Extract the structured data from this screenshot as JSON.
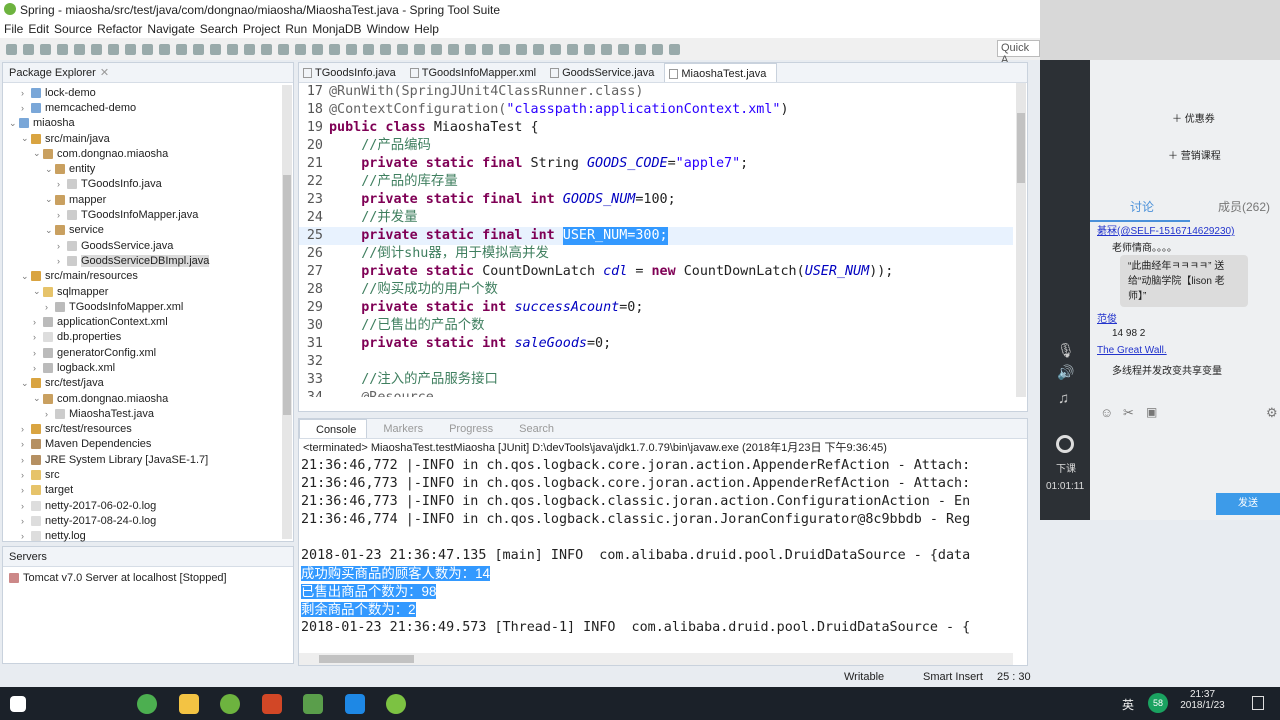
{
  "window": {
    "title": "Spring - miaosha/src/test/java/com/dongnao/miaosha/MiaoshaTest.java - Spring Tool Suite"
  },
  "menu": [
    "File",
    "Edit",
    "Source",
    "Refactor",
    "Navigate",
    "Search",
    "Project",
    "Run",
    "MonjaDB",
    "Window",
    "Help"
  ],
  "quick_access": "Quick A",
  "package_explorer": {
    "title": "Package Explorer",
    "items": [
      {
        "label": "lock-demo",
        "depth": 1,
        "icon": "project-icon"
      },
      {
        "label": "memcached-demo",
        "depth": 1,
        "icon": "project-icon"
      },
      {
        "label": "miaosha",
        "depth": 0,
        "icon": "project-icon",
        "expanded": true
      },
      {
        "label": "src/main/java",
        "depth": 1,
        "icon": "source-folder-icon",
        "expanded": true
      },
      {
        "label": "com.dongnao.miaosha",
        "depth": 2,
        "icon": "package-icon",
        "expanded": true
      },
      {
        "label": "entity",
        "depth": 3,
        "icon": "package-icon",
        "expanded": true
      },
      {
        "label": "TGoodsInfo.java",
        "depth": 4,
        "icon": "java-file-icon"
      },
      {
        "label": "mapper",
        "depth": 3,
        "icon": "package-icon",
        "expanded": true
      },
      {
        "label": "TGoodsInfoMapper.java",
        "depth": 4,
        "icon": "java-file-icon"
      },
      {
        "label": "service",
        "depth": 3,
        "icon": "package-icon",
        "expanded": true
      },
      {
        "label": "GoodsService.java",
        "depth": 4,
        "icon": "java-file-icon"
      },
      {
        "label": "GoodsServiceDBImpl.java",
        "depth": 4,
        "icon": "java-file-icon",
        "selected": true
      },
      {
        "label": "src/main/resources",
        "depth": 1,
        "icon": "source-folder-icon",
        "expanded": true
      },
      {
        "label": "sqlmapper",
        "depth": 2,
        "icon": "folder-icon",
        "expanded": true
      },
      {
        "label": "TGoodsInfoMapper.xml",
        "depth": 3,
        "icon": "xml-file-icon"
      },
      {
        "label": "applicationContext.xml",
        "depth": 2,
        "icon": "xml-file-icon"
      },
      {
        "label": "db.properties",
        "depth": 2,
        "icon": "file-icon"
      },
      {
        "label": "generatorConfig.xml",
        "depth": 2,
        "icon": "xml-file-icon"
      },
      {
        "label": "logback.xml",
        "depth": 2,
        "icon": "xml-file-icon"
      },
      {
        "label": "src/test/java",
        "depth": 1,
        "icon": "source-folder-icon",
        "expanded": true
      },
      {
        "label": "com.dongnao.miaosha",
        "depth": 2,
        "icon": "package-icon",
        "expanded": true
      },
      {
        "label": "MiaoshaTest.java",
        "depth": 3,
        "icon": "java-file-icon"
      },
      {
        "label": "src/test/resources",
        "depth": 1,
        "icon": "source-folder-icon"
      },
      {
        "label": "Maven Dependencies",
        "depth": 1,
        "icon": "library-icon"
      },
      {
        "label": "JRE System Library [JavaSE-1.7]",
        "depth": 1,
        "icon": "library-icon"
      },
      {
        "label": "src",
        "depth": 1,
        "icon": "folder-icon"
      },
      {
        "label": "target",
        "depth": 1,
        "icon": "folder-icon"
      },
      {
        "label": "netty-2017-06-02-0.log",
        "depth": 1,
        "icon": "file-icon"
      },
      {
        "label": "netty-2017-08-24-0.log",
        "depth": 1,
        "icon": "file-icon"
      },
      {
        "label": "netty.log",
        "depth": 1,
        "icon": "file-icon"
      }
    ]
  },
  "servers": {
    "title": "Servers",
    "items": [
      "Tomcat v7.0 Server at localhost  [Stopped]"
    ]
  },
  "editor": {
    "tabs": [
      "TGoodsInfo.java",
      "TGoodsInfoMapper.xml",
      "GoodsService.java",
      "MiaoshaTest.java"
    ],
    "active_tab": 3,
    "lines": [
      {
        "n": "17",
        "seg": [
          [
            "an",
            "@RunWith(SpringJUnit4ClassRunner.class)"
          ]
        ]
      },
      {
        "n": "18",
        "seg": [
          [
            "an",
            "@ContextConfiguration("
          ],
          [
            "str",
            "\"classpath:applicationContext.xml\""
          ],
          [
            "",
            ")"
          ]
        ]
      },
      {
        "n": "19",
        "seg": [
          [
            "kw",
            "public class "
          ],
          [
            "",
            "MiaoshaTest {"
          ]
        ]
      },
      {
        "n": "20",
        "seg": [
          [
            "cm",
            "    //产品编码"
          ]
        ]
      },
      {
        "n": "21",
        "seg": [
          [
            "kw",
            "    private static final "
          ],
          [
            "",
            "String "
          ],
          [
            "fld",
            "GOODS_CODE"
          ],
          [
            "",
            "="
          ],
          [
            "str",
            "\"apple7\""
          ],
          [
            "",
            ";"
          ]
        ]
      },
      {
        "n": "22",
        "seg": [
          [
            "cm",
            "    //产品的库存量"
          ]
        ]
      },
      {
        "n": "23",
        "seg": [
          [
            "kw",
            "    private static final int "
          ],
          [
            "fld",
            "GOODS_NUM"
          ],
          [
            "",
            "=100;"
          ]
        ]
      },
      {
        "n": "24",
        "seg": [
          [
            "cm",
            "    //并发量"
          ]
        ]
      },
      {
        "n": "25",
        "seg": [
          [
            "kw",
            "    private static final int "
          ],
          [
            "selt",
            "USER_NUM=300;"
          ]
        ],
        "current": true
      },
      {
        "n": "26",
        "seg": [
          [
            "cm",
            "    //倒计shu器，用于模拟高并发"
          ]
        ]
      },
      {
        "n": "27",
        "seg": [
          [
            "kw",
            "    private static "
          ],
          [
            "",
            "CountDownLatch "
          ],
          [
            "fld",
            "cdl"
          ],
          [
            "",
            " = "
          ],
          [
            "kw",
            "new "
          ],
          [
            "",
            "CountDownLatch("
          ],
          [
            "fld",
            "USER_NUM"
          ],
          [
            "",
            "));"
          ]
        ]
      },
      {
        "n": "28",
        "seg": [
          [
            "cm",
            "    //购买成功的用户个数"
          ]
        ]
      },
      {
        "n": "29",
        "seg": [
          [
            "kw",
            "    private static int "
          ],
          [
            "fld",
            "successAcount"
          ],
          [
            "",
            "=0;"
          ]
        ]
      },
      {
        "n": "30",
        "seg": [
          [
            "cm",
            "    //已售出的产品个数"
          ]
        ]
      },
      {
        "n": "31",
        "seg": [
          [
            "kw",
            "    private static int "
          ],
          [
            "fld",
            "saleGoods"
          ],
          [
            "",
            "=0;"
          ]
        ]
      },
      {
        "n": "32",
        "seg": [
          [
            "",
            ""
          ]
        ]
      },
      {
        "n": "33",
        "seg": [
          [
            "cm",
            "    //注入的产品服务接口"
          ]
        ]
      },
      {
        "n": "34",
        "seg": [
          [
            "an",
            "    @Resource"
          ]
        ]
      }
    ]
  },
  "console": {
    "tabs": [
      "Console",
      "Markers",
      "Progress",
      "Search"
    ],
    "header": "<terminated> MiaoshaTest.testMiaosha [JUnit] D:\\devTools\\java\\jdk1.7.0.79\\bin\\javaw.exe (2018年1月23日 下午9:36:45)",
    "lines": [
      "21:36:46,772 |-INFO in ch.qos.logback.core.joran.action.AppenderRefAction - Attach:",
      "21:36:46,773 |-INFO in ch.qos.logback.core.joran.action.AppenderRefAction - Attach:",
      "21:36:46,773 |-INFO in ch.qos.logback.classic.joran.action.ConfigurationAction - En",
      "21:36:46,774 |-INFO in ch.qos.logback.classic.joran.JoranConfigurator@8c9bbdb - Reg",
      "",
      "2018-01-23 21:36:47.135 [main] INFO  com.alibaba.druid.pool.DruidDataSource - {data",
      "成功购买商品的顾客人数为：14",
      "已售出商品个数为：98",
      "剩余商品个数为：2",
      "2018-01-23 21:36:49.573 [Thread-1] INFO  com.alibaba.druid.pool.DruidDataSource - {"
    ],
    "highlighted": [
      6,
      7,
      8
    ]
  },
  "status": {
    "writable": "Writable",
    "insert": "Smart Insert",
    "position": "25 : 30"
  },
  "chat": {
    "menu": [
      "优惠券",
      "营销课程"
    ],
    "tabs": [
      "讨论",
      "成员(262)"
    ],
    "messages": [
      {
        "user": "綦冧(@SELF-1516714629230)",
        "text": "老师情商。。。。"
      },
      {
        "gift": "“此曲经年ㅋㅋㅋㅋ” 送给“动脑学院【lison 老师】”"
      },
      {
        "user": "范俊",
        "text": "14 98 2"
      },
      {
        "user": "The Great Wall.",
        "text": "多线程并发改变共享变量"
      }
    ],
    "send": "发送",
    "end_class": "下课",
    "timer": "01:01:11"
  },
  "taskbar": {
    "time": "21:37",
    "date": "2018/1/23",
    "ime": "英",
    "badge": "58"
  }
}
